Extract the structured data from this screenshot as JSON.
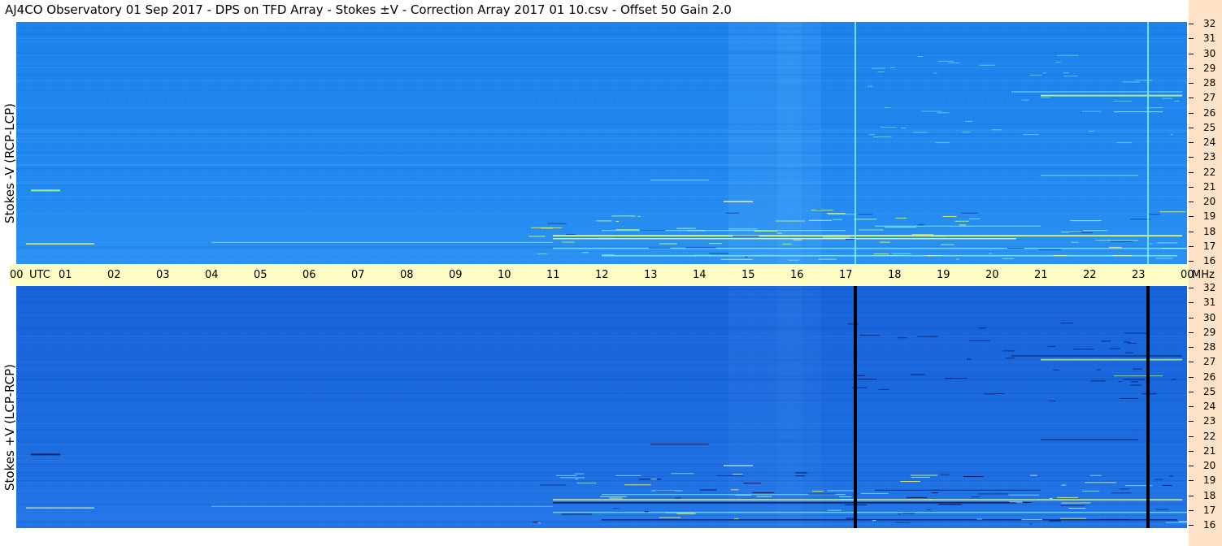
{
  "title": "AJ4CO Observatory  01 Sep 2017  -  DPS on TFD Array  -  Stokes ±V  -  Correction Array 2017 01 10.csv  -  Offset 50  Gain 2.0",
  "top_panel_label": "Stokes -V (RCP-LCP)",
  "bottom_panel_label": "Stokes +V (LCP-RCP)",
  "time_axis": {
    "first_label": "00",
    "unit_label": "UTC",
    "labels": [
      "01",
      "02",
      "03",
      "04",
      "05",
      "06",
      "07",
      "08",
      "09",
      "10",
      "11",
      "12",
      "13",
      "14",
      "15",
      "16",
      "17",
      "18",
      "19",
      "20",
      "21",
      "22",
      "23",
      "00"
    ]
  },
  "freq_unit": "MHz",
  "freq_labels": [
    "32",
    "31",
    "30",
    "29",
    "28",
    "27",
    "26",
    "25",
    "24",
    "23",
    "22",
    "21",
    "20",
    "19",
    "18",
    "17",
    "16"
  ],
  "chart_data": [
    {
      "type": "heatmap",
      "title": "Stokes -V (RCP-LCP)",
      "xlabel": "UTC",
      "ylabel": "MHz",
      "xlim": [
        0,
        24
      ],
      "ylim": [
        16,
        32
      ],
      "notes": "dynamic spectrum; narrowband emission lines around 16-18 MHz after 11 UTC; vertical bright lines near 17.2 and 23.2 UTC",
      "colors": {
        "background": "#1c86f0",
        "bright_line": "#7ef0ff"
      }
    },
    {
      "type": "heatmap",
      "title": "Stokes +V (LCP-RCP)",
      "xlabel": "UTC",
      "ylabel": "MHz",
      "xlim": [
        0,
        24
      ],
      "ylim": [
        16,
        32
      ],
      "notes": "dynamic spectrum; narrowband lines around 16-18 MHz after 11 UTC; vertical dark lines near 17.2 and 23.2 UTC",
      "colors": {
        "background": "#1768e0",
        "dark_line": "#000000"
      }
    }
  ],
  "colors": {
    "timebar": "#fffdc4",
    "right_strip": "#fde2c8",
    "emission_yellow": "#f4ff6a",
    "emission_cyan": "#7ef0ff"
  }
}
